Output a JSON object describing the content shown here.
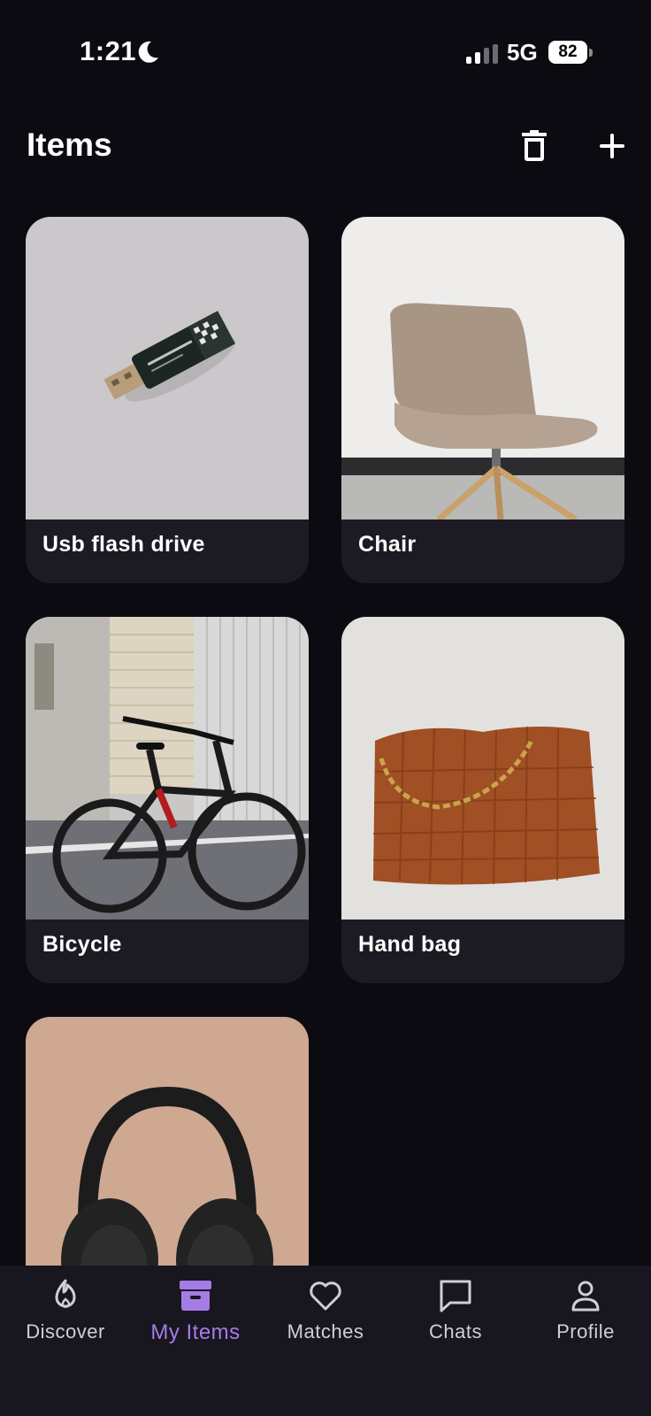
{
  "status_bar": {
    "time": "1:21",
    "network": "5G",
    "battery": "82"
  },
  "header": {
    "title": "Items"
  },
  "items": [
    {
      "label": "Usb flash drive"
    },
    {
      "label": "Chair"
    },
    {
      "label": "Bicycle"
    },
    {
      "label": "Hand bag"
    },
    {
      "label": ""
    }
  ],
  "nav": [
    {
      "label": "Discover",
      "icon": "flame-icon"
    },
    {
      "label": "My Items",
      "icon": "archive-box-icon"
    },
    {
      "label": "Matches",
      "icon": "heart-icon"
    },
    {
      "label": "Chats",
      "icon": "chat-bubble-icon"
    },
    {
      "label": "Profile",
      "icon": "person-icon"
    }
  ],
  "colors": {
    "background": "#0c0b12",
    "card": "#1c1a23",
    "accent": "#a47ce6",
    "nav_bg": "#18161f"
  }
}
